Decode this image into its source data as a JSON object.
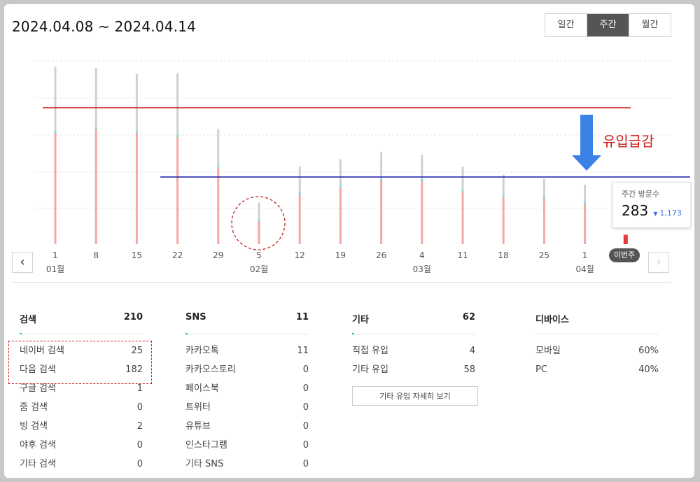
{
  "header": {
    "date_range": "2024.04.08 ~ 2024.04.14",
    "period_tabs": [
      {
        "label": "일간",
        "active": false
      },
      {
        "label": "주간",
        "active": true
      },
      {
        "label": "월간",
        "active": false
      }
    ]
  },
  "chart_data": {
    "type": "bar",
    "categories": [
      "1",
      "8",
      "15",
      "22",
      "29",
      "5",
      "12",
      "19",
      "26",
      "4",
      "11",
      "18",
      "25",
      "1",
      ""
    ],
    "month_labels": [
      {
        "index": 0,
        "label": "01월"
      },
      {
        "index": 5,
        "label": "02월"
      },
      {
        "index": 9,
        "label": "03월"
      },
      {
        "index": 13,
        "label": "04월"
      }
    ],
    "stacked": true,
    "series": [
      {
        "values": [
          530,
          546,
          528,
          510,
          364,
          110,
          235,
          271,
          305,
          300,
          251,
          226,
          216,
          192,
          45
        ],
        "color": "#f5a7a2"
      },
      {
        "values": [
          10,
          10,
          10,
          10,
          10,
          8,
          10,
          10,
          10,
          10,
          10,
          10,
          10,
          10,
          0
        ],
        "color": "#7fd8d8"
      },
      {
        "values": [
          305,
          284,
          274,
          294,
          174,
          80,
          125,
          124,
          124,
          115,
          107,
          95,
          86,
          81,
          0
        ],
        "color": "#ccd1d6"
      }
    ],
    "grid": true,
    "ylim": [
      0,
      1000
    ],
    "current_bar_color": "#e53b3b"
  },
  "overlay": {
    "red_line_color": "#cc1111",
    "blue_line_color": "#1a1aaa",
    "arrow_color": "#3b82e6",
    "drop_label": "유입급감",
    "circle_color": "#c02020"
  },
  "tooltip": {
    "label": "주간 방문수",
    "value": "283",
    "arrow": "▼",
    "change": "1,173"
  },
  "current_week_badge": "이번주",
  "nav": {
    "prev": "‹",
    "next": "›"
  },
  "stats": {
    "search": {
      "title": "검색",
      "total": "210",
      "items": [
        {
          "label": "네이버 검색",
          "value": "25"
        },
        {
          "label": "다음 검색",
          "value": "182"
        },
        {
          "label": "구글 검색",
          "value": "1"
        },
        {
          "label": "줌 검색",
          "value": "0"
        },
        {
          "label": "빙 검색",
          "value": "2"
        },
        {
          "label": "야후 검색",
          "value": "0"
        },
        {
          "label": "기타 검색",
          "value": "0"
        }
      ]
    },
    "sns": {
      "title": "SNS",
      "total": "11",
      "items": [
        {
          "label": "카카오톡",
          "value": "11"
        },
        {
          "label": "카카오스토리",
          "value": "0"
        },
        {
          "label": "페이스북",
          "value": "0"
        },
        {
          "label": "트위터",
          "value": "0"
        },
        {
          "label": "유튜브",
          "value": "0"
        },
        {
          "label": "인스타그램",
          "value": "0"
        },
        {
          "label": "기타 SNS",
          "value": "0"
        }
      ]
    },
    "etc": {
      "title": "기타",
      "total": "62",
      "items": [
        {
          "label": "직접 유입",
          "value": "4"
        },
        {
          "label": "기타 유입",
          "value": "58"
        }
      ],
      "detail_button": "기타 유입 자세히 보기"
    },
    "device": {
      "title": "디바이스",
      "items": [
        {
          "label": "모바일",
          "value": "60%"
        },
        {
          "label": "PC",
          "value": "40%"
        }
      ]
    }
  }
}
